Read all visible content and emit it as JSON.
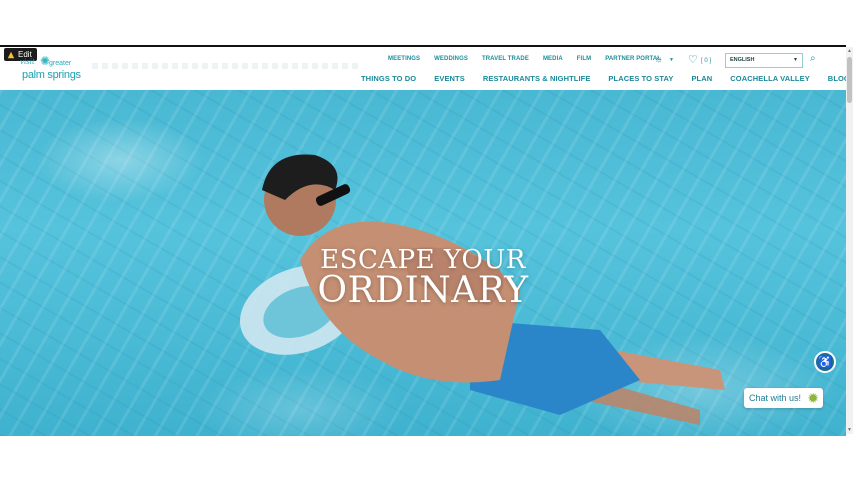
{
  "toolbar": {
    "edit_label": "Edit"
  },
  "logo": {
    "visit": "visit",
    "greater": "greater",
    "palm_springs": "palm springs"
  },
  "util_nav": [
    "MEETINGS",
    "WEDDINGS",
    "TRAVEL TRADE",
    "MEDIA",
    "FILM",
    "PARTNER PORTAL"
  ],
  "favorites": {
    "count": "[ 0 ]"
  },
  "language": {
    "selected": "ENGLISH"
  },
  "main_nav": [
    "THINGS TO DO",
    "EVENTS",
    "RESTAURANTS & NIGHTLIFE",
    "PLACES TO STAY",
    "PLAN",
    "COACHELLA VALLEY",
    "BLOG"
  ],
  "hero": {
    "line1": "ESCAPE YOUR",
    "line2": "ORDINARY"
  },
  "chat": {
    "label": "Chat with us!"
  },
  "icons": {
    "edit": "edit-icon",
    "sun": "sun-icon",
    "heart": "heart-icon",
    "search": "search-icon",
    "accessibility": "accessibility-icon",
    "chat": "chat-icon"
  },
  "colors": {
    "brand_teal": "#1a8a98",
    "water": "#49b8d3"
  }
}
